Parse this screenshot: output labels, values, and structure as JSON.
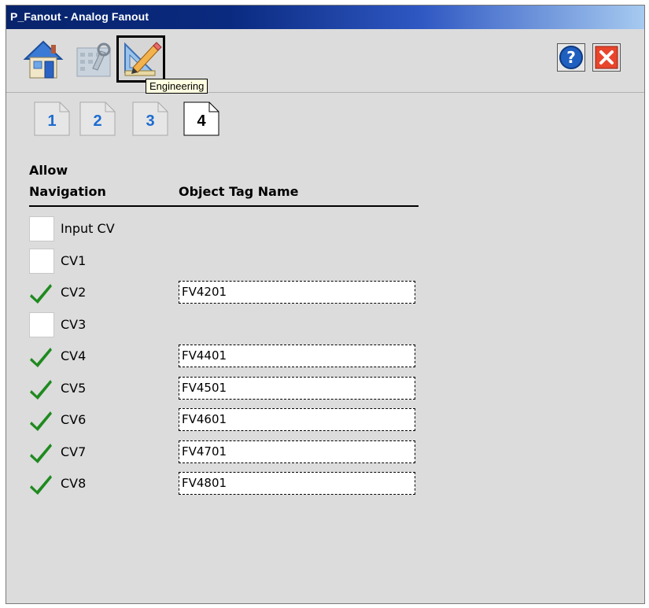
{
  "window": {
    "title": "P_Fanout - Analog Fanout"
  },
  "toolbar": {
    "buttons": [
      {
        "name": "home",
        "icon": "home-icon"
      },
      {
        "name": "maintenance",
        "icon": "maintenance-icon"
      },
      {
        "name": "engineering",
        "icon": "engineering-icon",
        "selected": true
      }
    ],
    "help_icon": "help-icon",
    "close_icon": "close-icon",
    "tooltip": "Engineering"
  },
  "pages": {
    "tabs": [
      "1",
      "2",
      "3",
      "4"
    ],
    "active": "4"
  },
  "table": {
    "col1_line1": "Allow",
    "col1_line2": "Navigation",
    "col2": "Object Tag Name"
  },
  "rows": [
    {
      "label": "Input CV",
      "checked": false,
      "tag": ""
    },
    {
      "label": "CV1",
      "checked": false,
      "tag": ""
    },
    {
      "label": "CV2",
      "checked": true,
      "tag": "FV4201"
    },
    {
      "label": "CV3",
      "checked": false,
      "tag": ""
    },
    {
      "label": "CV4",
      "checked": true,
      "tag": "FV4401"
    },
    {
      "label": "CV5",
      "checked": true,
      "tag": "FV4501"
    },
    {
      "label": "CV6",
      "checked": true,
      "tag": "FV4601"
    },
    {
      "label": "CV7",
      "checked": true,
      "tag": "FV4701"
    },
    {
      "label": "CV8",
      "checked": true,
      "tag": "FV4801"
    }
  ],
  "colors": {
    "check": "#1f8a1f",
    "page_number": "#1c6cd0",
    "close_red": "#e8452c",
    "help_blue": "#1f5fbf"
  }
}
